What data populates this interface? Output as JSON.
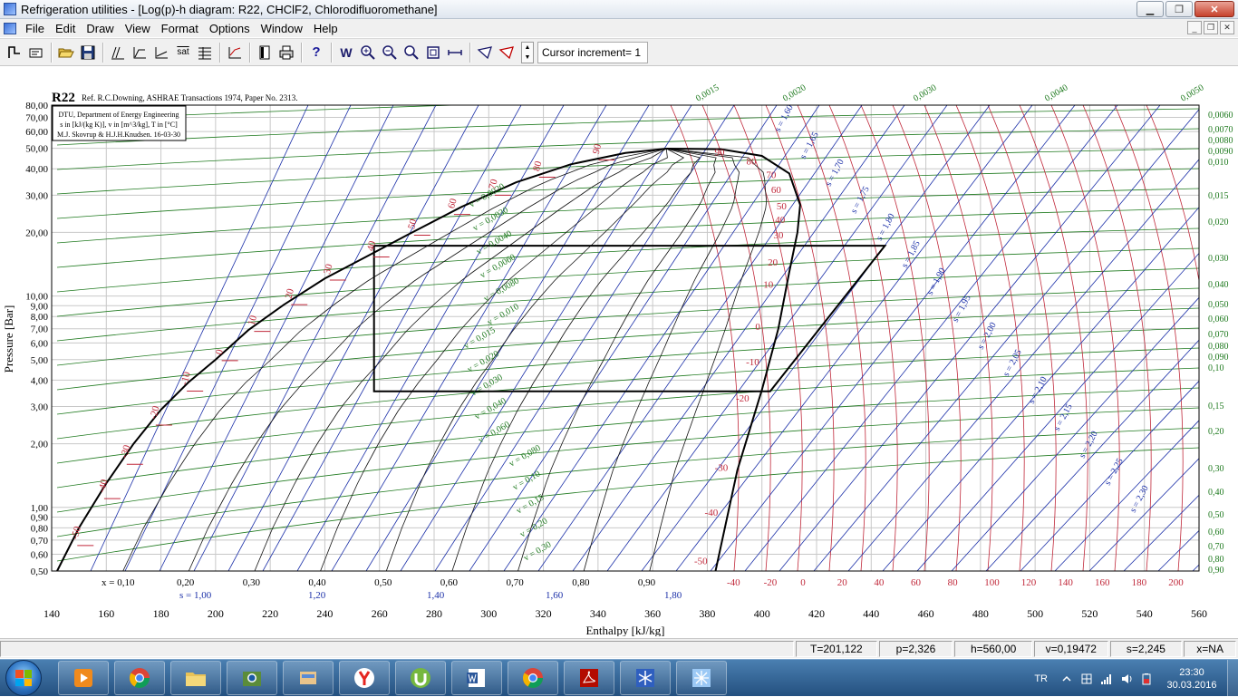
{
  "window": {
    "title": "Refrigeration utilities - [Log(p)-h diagram: R22, CHClF2, Chlorodifluoromethane]",
    "minimize": "▁",
    "maximize": "❐",
    "close": "✕"
  },
  "menu": {
    "items": [
      "File",
      "Edit",
      "Draw",
      "View",
      "Format",
      "Options",
      "Window",
      "Help"
    ],
    "mdi_minimize": "_",
    "mdi_restore": "❐",
    "mdi_close": "✕"
  },
  "toolbar": {
    "sat_label": "sat",
    "help_label": "?",
    "w_label": "W",
    "cursor_increment": "Cursor increment= 1"
  },
  "chart_data": {
    "type": "line",
    "subtype": "log(p)-h refrigerant diagram",
    "refrigerant_label": "R22",
    "reference": "Ref. R.C.Downing, ASHRAE Transactions 1974, Paper No. 2313.",
    "info_box": [
      "DTU, Department of Energy Engineering",
      "s in [kJ/(kg K)], v in [m^3/kg], T in [°C]",
      "M.J. Skovrup & H.J.H.Knudsen. 16-03-30"
    ],
    "xlabel": "Enthalpy [kJ/kg]",
    "ylabel": "Pressure [Bar]",
    "x_range": [
      140,
      560
    ],
    "y_range": [
      0.5,
      80
    ],
    "y_scale": "log",
    "x_ticks": [
      140,
      160,
      180,
      200,
      220,
      240,
      260,
      280,
      300,
      320,
      340,
      360,
      380,
      400,
      420,
      440,
      460,
      480,
      500,
      520,
      540,
      560
    ],
    "x_tick_labels": [
      "140",
      "160",
      "180",
      "200",
      "220",
      "240",
      "260",
      "280",
      "300",
      "320",
      "340",
      "360",
      "380",
      "400",
      "420",
      "440",
      "460",
      "480",
      "500",
      "520",
      "540",
      "560"
    ],
    "y_ticks": [
      0.5,
      0.6,
      0.7,
      0.8,
      0.9,
      1,
      2,
      3,
      4,
      5,
      6,
      7,
      8,
      9,
      10,
      20,
      30,
      40,
      50,
      60,
      70,
      80
    ],
    "y_tick_labels": [
      "0,50",
      "0,60",
      "0,70",
      "0,80",
      "0,90",
      "1,00",
      "2,00",
      "3,00",
      "4,00",
      "5,00",
      "6,00",
      "7,00",
      "8,00",
      "9,00",
      "10,00",
      "20,00",
      "30,00",
      "40,00",
      "50,00",
      "60,00",
      "70,00",
      "80,00"
    ],
    "grid": true,
    "saturation_liquid": [
      [
        142,
        0.5
      ],
      [
        150,
        0.8
      ],
      [
        160,
        1.3
      ],
      [
        170,
        2.0
      ],
      [
        180,
        2.9
      ],
      [
        190,
        3.9
      ],
      [
        200,
        5.0
      ],
      [
        212,
        6.9
      ],
      [
        225,
        9.1
      ],
      [
        240,
        12.1
      ],
      [
        255,
        15.3
      ],
      [
        270,
        19.4
      ],
      [
        290,
        26.4
      ],
      [
        310,
        34.5
      ],
      [
        330,
        42.0
      ],
      [
        350,
        47.5
      ],
      [
        365,
        49.8
      ]
    ],
    "saturation_vapor": [
      [
        383,
        0.5
      ],
      [
        391,
        1.5
      ],
      [
        400,
        3.6
      ],
      [
        406,
        7.0
      ],
      [
        410,
        13.0
      ],
      [
        413,
        20.0
      ],
      [
        414,
        27.0
      ],
      [
        410,
        38.0
      ],
      [
        400,
        46.0
      ],
      [
        385,
        49.5
      ],
      [
        365,
        49.8
      ]
    ],
    "cycle": [
      [
        258,
        17.3
      ],
      [
        445,
        17.3
      ],
      [
        403,
        3.54
      ],
      [
        258,
        3.54
      ],
      [
        258,
        17.3
      ]
    ],
    "quality_labels": [
      "x = 0,10",
      "0,20",
      "0,30",
      "0,40",
      "0,50",
      "0,60",
      "0,70",
      "0,80",
      "0,90"
    ],
    "entropy_bottom_labels": [
      "s = 1,00",
      "1,20",
      "1,40",
      "1,60",
      "1,80"
    ],
    "isentrope_labels": [
      "s = 1,60",
      "s = 1,65",
      "s = 1,70",
      "s = 1,75",
      "s = 1,80",
      "s = 1,85",
      "s = 1,90",
      "s = 1,95",
      "s = 2,00",
      "s = 2,05",
      "s = 2,10",
      "s = 2,15",
      "s = 2,20",
      "s = 2,25",
      "s = 2,30"
    ],
    "isochore_labels_left": [
      "v = 0,0020",
      "v = 0,0030",
      "v = 0,0040",
      "v = 0,0060",
      "v = 0,0080",
      "v = 0,010",
      "v = 0,015",
      "v = 0,020",
      "v = 0,030",
      "v = 0,040",
      "v = 0,060",
      "v = 0,080",
      "v = 0,10",
      "v = 0,15",
      "v = 0,20",
      "v = 0,30"
    ],
    "isochore_labels_right": [
      "0,0060",
      "0,0070",
      "0,0080",
      "0,0090",
      "0,010",
      "0,015",
      "0,020",
      "0,030",
      "0,040",
      "0,050",
      "0,060",
      "0,070",
      "0,080",
      "0,090",
      "0,10",
      "0,15",
      "0,20",
      "0,30",
      "0,40",
      "0,50",
      "0,60",
      "0,70",
      "0,80",
      "0,90"
    ],
    "isochore_labels_top": [
      "0,0015",
      "0,0020",
      "0,0030",
      "0,0040",
      "0,0050"
    ],
    "isotherm_labels_liquid": [
      "-50",
      "-40",
      "-30",
      "-20",
      "-10",
      "0",
      "10",
      "20",
      "30",
      "40",
      "50",
      "60",
      "70",
      "80",
      "90"
    ],
    "isotherm_labels_vapor": [
      "90",
      "80",
      "70",
      "60",
      "50",
      "40",
      "30",
      "20",
      "10",
      "0",
      "-10",
      "-20",
      "-30",
      "-40",
      "-50"
    ],
    "isotherm_labels_bottom": [
      "-40",
      "-20",
      "0",
      "20",
      "40",
      "60",
      "80",
      "100",
      "120",
      "140",
      "160",
      "180",
      "200"
    ]
  },
  "status": {
    "T": "T=201,122",
    "p": "p=2,326",
    "h": "h=560,00",
    "v": "v=0,19472",
    "s": "s=2,245",
    "x": "x=NA"
  },
  "taskbar": {
    "language": "TR",
    "time": "23:30",
    "date": "30.03.2016"
  }
}
